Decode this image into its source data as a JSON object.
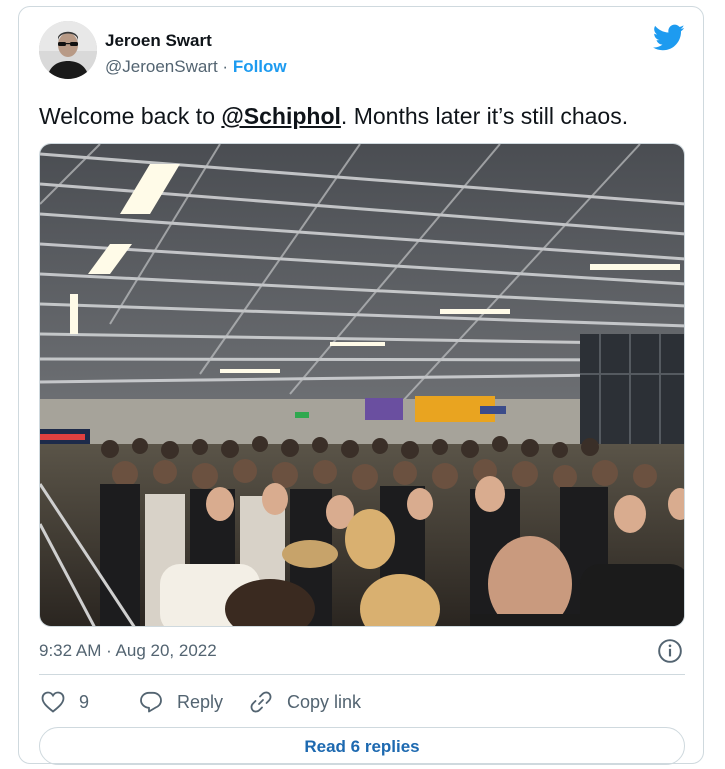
{
  "author": {
    "name": "Jeroen Swart",
    "handle": "@JeroenSwart",
    "separator": " · ",
    "follow_label": "Follow"
  },
  "tweet": {
    "text_before": "Welcome back to ",
    "mention": "@Schiphol",
    "text_after": ". Months later it’s still chaos.",
    "timestamp": "9:32 AM · Aug 20, 2022"
  },
  "actions": {
    "like_count": "9",
    "reply_label": "Reply",
    "copy_link_label": "Copy link",
    "read_replies_label": "Read 6 replies"
  },
  "icons": [
    "twitter-bird-icon",
    "info-icon",
    "heart-icon",
    "reply-icon",
    "link-icon"
  ],
  "colors": {
    "accent": "#1d9bf0",
    "read_replies": "#1d69b0",
    "muted": "#536471",
    "border": "#cfd9de",
    "text": "#0f1419"
  }
}
